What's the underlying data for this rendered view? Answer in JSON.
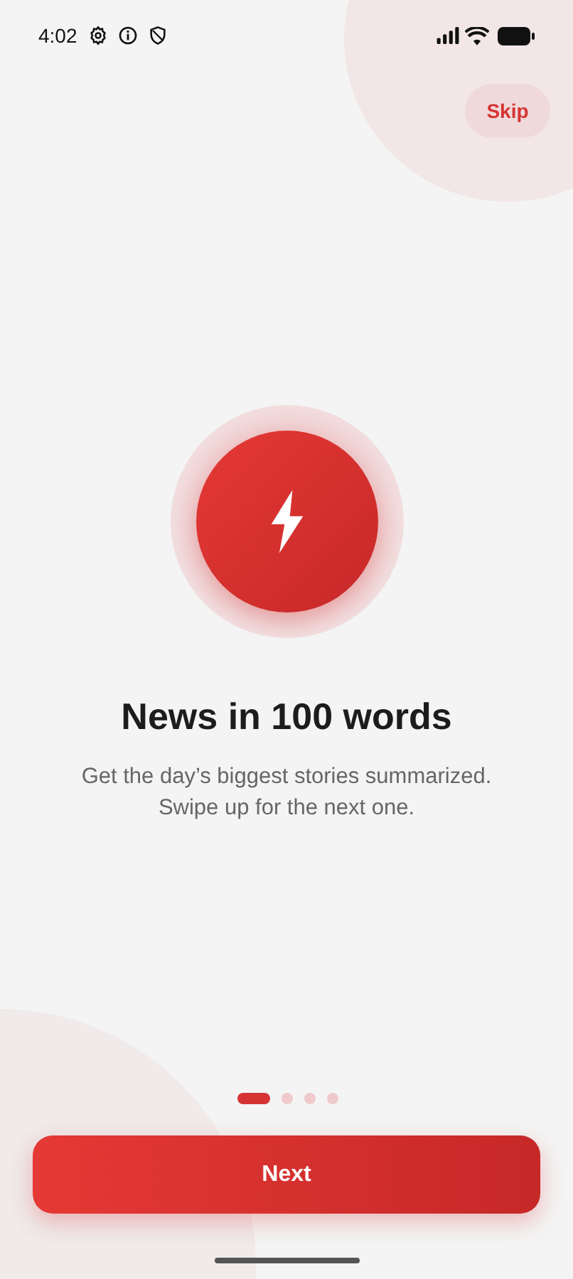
{
  "status_bar": {
    "time": "4:02"
  },
  "skip_button": {
    "label": "Skip"
  },
  "title": "News in 100 words",
  "subtitle": "Get the day’s biggest stories summarized. Swipe up for the next one.",
  "pages": [
    {
      "selected": true
    },
    {
      "selected": false
    },
    {
      "selected": false
    },
    {
      "selected": false
    }
  ],
  "next_button": {
    "label": "Next"
  }
}
